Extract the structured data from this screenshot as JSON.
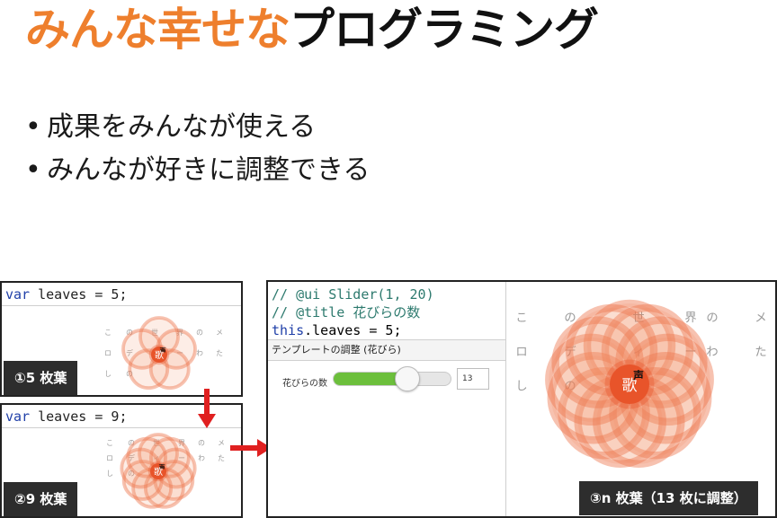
{
  "title": {
    "orange": "みんな幸せな",
    "black": "プログラミング"
  },
  "bullets": [
    {
      "dot": "•",
      "text": "成果をみんなが使える"
    },
    {
      "dot": "•",
      "text": "みんなが好きに調整できる"
    }
  ],
  "lyrics": {
    "row1": [
      "こ",
      "の",
      "世",
      "界",
      "の",
      "メ"
    ],
    "row2": [
      "ロ",
      "デ",
      "ィ",
      "ー",
      "わ",
      "た"
    ],
    "row3": [
      "し",
      "の"
    ],
    "center_top": "声",
    "center_main": "歌"
  },
  "panel1": {
    "code": {
      "keyword": "var",
      "rest": " leaves = ",
      "value": "5",
      "end": ";"
    },
    "badge": "①5 枚葉",
    "leaves": 5
  },
  "panel2": {
    "code": {
      "keyword": "var",
      "rest": " leaves = ",
      "value": "9",
      "end": ";"
    },
    "badge": "②9 枚葉",
    "leaves": 9
  },
  "panel3": {
    "code_line1": "// @ui Slider(1, 20)",
    "code_line2": "// @title 花びらの数",
    "code_line3_kw": "this",
    "code_line3_rest": ".leaves = 5;",
    "template_title": "テンプレートの調整 (花びら)",
    "slider_label": "花びらの数",
    "slider_value": "13",
    "slider_min": 1,
    "slider_max": 20,
    "badge": "③n 枚葉（13 枚に調整）",
    "leaves": 13
  },
  "colors": {
    "orange": "#ee7f2d",
    "petal": "#f2a07a",
    "center": "#e8542a",
    "slider_fill": "#6cbf3c",
    "arrow": "#e02020"
  }
}
